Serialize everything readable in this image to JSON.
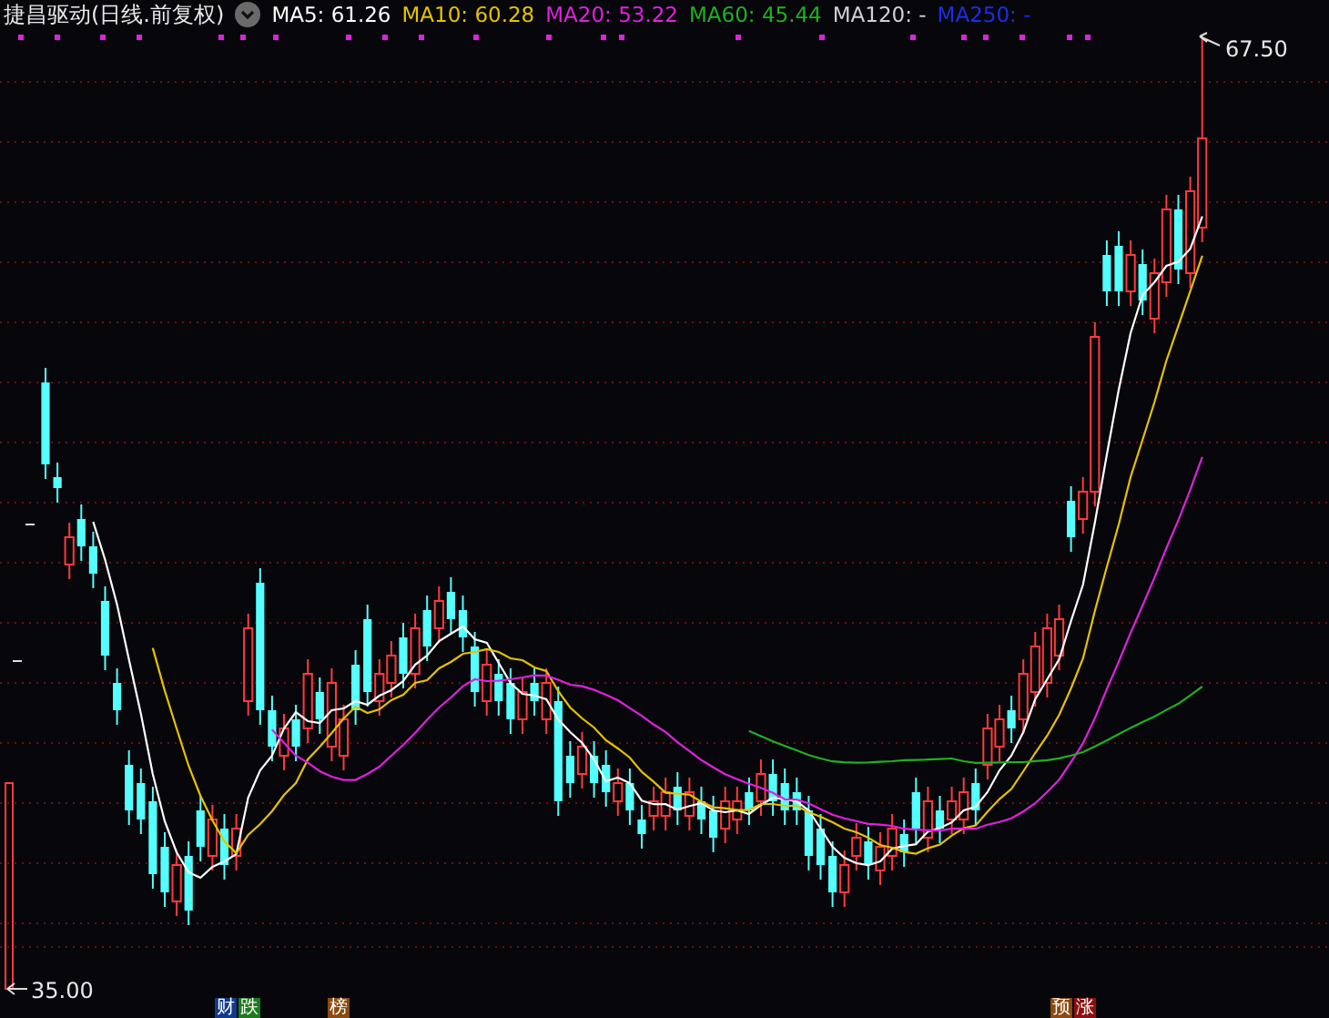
{
  "chart_header": {
    "title": "捷昌驱动(日线.前复权)",
    "ma_legend": [
      {
        "label": "MA5:",
        "value": "61.26",
        "color": "#ffffff"
      },
      {
        "label": "MA10:",
        "value": "60.28",
        "color": "#e6c200"
      },
      {
        "label": "MA20:",
        "value": "53.22",
        "color": "#e020e0"
      },
      {
        "label": "MA60:",
        "value": "45.44",
        "color": "#20b020"
      },
      {
        "label": "MA120:",
        "value": "-",
        "color": "#d0d0d0"
      },
      {
        "label": "MA250:",
        "value": "-",
        "color": "#1a2ee8"
      }
    ]
  },
  "price_labels": {
    "high": "67.50",
    "low": "35.00"
  },
  "event_badges": [
    {
      "text": "财",
      "color": "#123a8c"
    },
    {
      "text": "跌",
      "color": "#1e7a1e"
    },
    {
      "text": "榜",
      "color": "#8a4a10"
    },
    {
      "text": "预",
      "color": "#8a4a10"
    },
    {
      "text": "涨",
      "color": "#8c1010"
    }
  ]
}
